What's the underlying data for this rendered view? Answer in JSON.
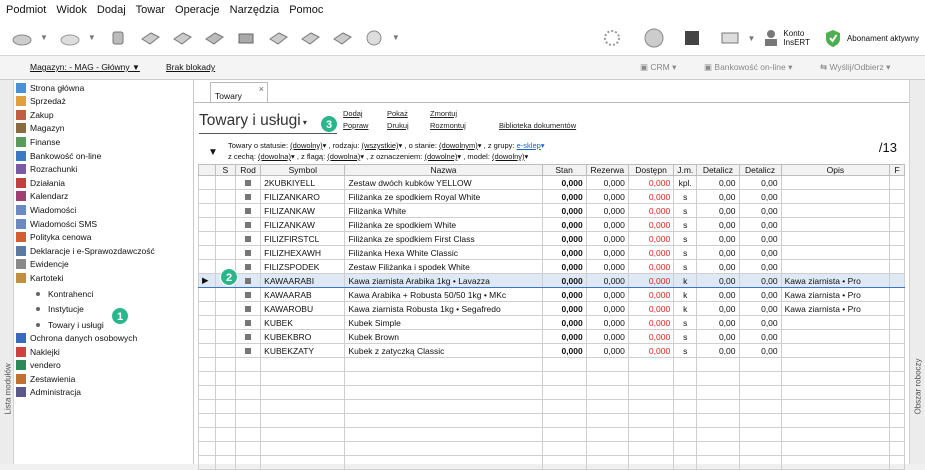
{
  "menu": [
    "Podmiot",
    "Widok",
    "Dodaj",
    "Towar",
    "Operacje",
    "Narzędzia",
    "Pomoc"
  ],
  "toolbar": {
    "konto_line1": "Konto",
    "konto_line2": "InsERT",
    "abonament": "Abonament aktywny",
    "icons": [
      "home-icon",
      "mail-icon",
      "database-icon",
      "document-icon",
      "invoice-icon",
      "tag-icon",
      "printer-icon",
      "tools-icon",
      "wrench-icon",
      "pen-icon",
      "help-icon",
      "spinner-icon",
      "globe-icon",
      "box-icon",
      "truck-icon",
      "account-icon",
      "shield-check-icon"
    ]
  },
  "bar2": {
    "magazyn": "Magazyn: - MAG - Główny",
    "brak_blokady": "Brak blokady",
    "crm": "CRM",
    "bankowosc": "Bankowość on-line",
    "wyslij": "Wyślij/Odbierz"
  },
  "left_strip_label": "Lista modułów",
  "right_strip_label": "Obszar roboczy",
  "nav": {
    "items": [
      "Strona główna",
      "Sprzedaż",
      "Zakup",
      "Magazyn",
      "Finanse",
      "Bankowość on-line",
      "Rozrachunki",
      "Działania",
      "Kalendarz",
      "Wiadomości",
      "Wiadomości SMS",
      "Polityka cenowa",
      "Deklaracje i e-Sprawozdawczość",
      "Ewidencje",
      "Kartoteki"
    ],
    "subitems": [
      "Kontrahenci",
      "Instytucje",
      "Towary i usługi"
    ],
    "items_after": [
      "Ochrona danych osobowych",
      "Naklejki",
      "vendero",
      "Zestawienia",
      "Administracja"
    ]
  },
  "tab": {
    "label": "Towary",
    "close": "×"
  },
  "title": "Towary i usługi",
  "links": {
    "dodaj": "Dodaj",
    "popraw": "Popraw",
    "pokaz": "Pokaż",
    "drukuj": "Drukuj",
    "zmontuj": "Zmontuj",
    "rozmontuj": "Rozmontuj",
    "biblioteka": "Biblioteka dokumentów"
  },
  "filters": {
    "row1": {
      "status_label": "Towary o statusie:",
      "status_val": "(dowolny)",
      "rodzaj_label": ", rodzaju:",
      "rodzaj_val": "(wszystkie)",
      "stan_label": ", o stanie:",
      "stan_val": "(dowolnym)",
      "grupy_label": ", z grupy:",
      "grupy_val": "e-sklep"
    },
    "row2": {
      "cecha_label": "z cechą:",
      "cecha_val": "(dowolna)",
      "flaga_label": ", z flagą:",
      "flaga_val": "(dowolna)",
      "ozn_label": ", z oznaczeniem:",
      "ozn_val": "(dowolne)",
      "model_label": ", model:",
      "model_val": "(dowolny)"
    }
  },
  "counter": "/13",
  "table": {
    "headers": [
      "S",
      "Rod",
      "Symbol",
      "Nazwa",
      "Stan",
      "Rezerwa",
      "Dostępn",
      "J.m.",
      "Detalicz",
      "Detalicz",
      "Opis",
      "F"
    ],
    "rows": [
      [
        "2KUBKIYELL",
        "Zestaw dwóch kubków YELLOW",
        "0,000",
        "0,000",
        "0,000",
        "kpl.",
        "0,00",
        "0,00",
        ""
      ],
      [
        "FILIZANKARO",
        "Filiżanka ze spodkiem Royal White",
        "0,000",
        "0,000",
        "0,000",
        "s",
        "0,00",
        "0,00",
        ""
      ],
      [
        "FILIZANKAW",
        "Filiżanka White",
        "0,000",
        "0,000",
        "0,000",
        "s",
        "0,00",
        "0,00",
        ""
      ],
      [
        "FILIZANKAW",
        "Filiżanka ze spodkiem White",
        "0,000",
        "0,000",
        "0,000",
        "s",
        "0,00",
        "0,00",
        ""
      ],
      [
        "FILIZFIRSTCL",
        "Filiżanka ze spodkiem First Class",
        "0,000",
        "0,000",
        "0,000",
        "s",
        "0,00",
        "0,00",
        ""
      ],
      [
        "FILIZHEXAWH",
        "Filiżanka Hexa White Classic",
        "0,000",
        "0,000",
        "0,000",
        "s",
        "0,00",
        "0,00",
        ""
      ],
      [
        "FILIZSPODEK",
        "Zestaw Filiżanka i spodek White",
        "0,000",
        "0,000",
        "0,000",
        "s",
        "0,00",
        "0,00",
        ""
      ],
      [
        "KAWAARABI",
        "Kawa ziarnista Arabika 1kg • Lavazza",
        "0,000",
        "0,000",
        "0,000",
        "k",
        "0,00",
        "0,00",
        "Kawa ziarnista • Pro"
      ],
      [
        "KAWAARAB",
        "Kawa Arabika + Robusta 50/50 1kg • MKc",
        "0,000",
        "0,000",
        "0,000",
        "k",
        "0,00",
        "0,00",
        "Kawa ziarnista • Pro"
      ],
      [
        "KAWAROBU",
        "Kawa ziarnista Robusta 1kg • Segafredo",
        "0,000",
        "0,000",
        "0,000",
        "k",
        "0,00",
        "0,00",
        "Kawa ziarnista • Pro"
      ],
      [
        "KUBEK",
        "Kubek Simple",
        "0,000",
        "0,000",
        "0,000",
        "s",
        "0,00",
        "0,00",
        ""
      ],
      [
        "KUBEKBRO",
        "Kubek Brown",
        "0,000",
        "0,000",
        "0,000",
        "s",
        "0,00",
        "0,00",
        ""
      ],
      [
        "KUBEKZATY",
        "Kubek z zatyczką Classic",
        "0,000",
        "0,000",
        "0,000",
        "s",
        "0,00",
        "0,00",
        ""
      ]
    ],
    "selected_row": 7
  },
  "badges": [
    "1",
    "2",
    "3"
  ],
  "colors": {
    "badge": "#2ab68a",
    "red_value": "#e21d1d",
    "selection": "#dfe9f6",
    "link_blue": "#1a63c9"
  }
}
